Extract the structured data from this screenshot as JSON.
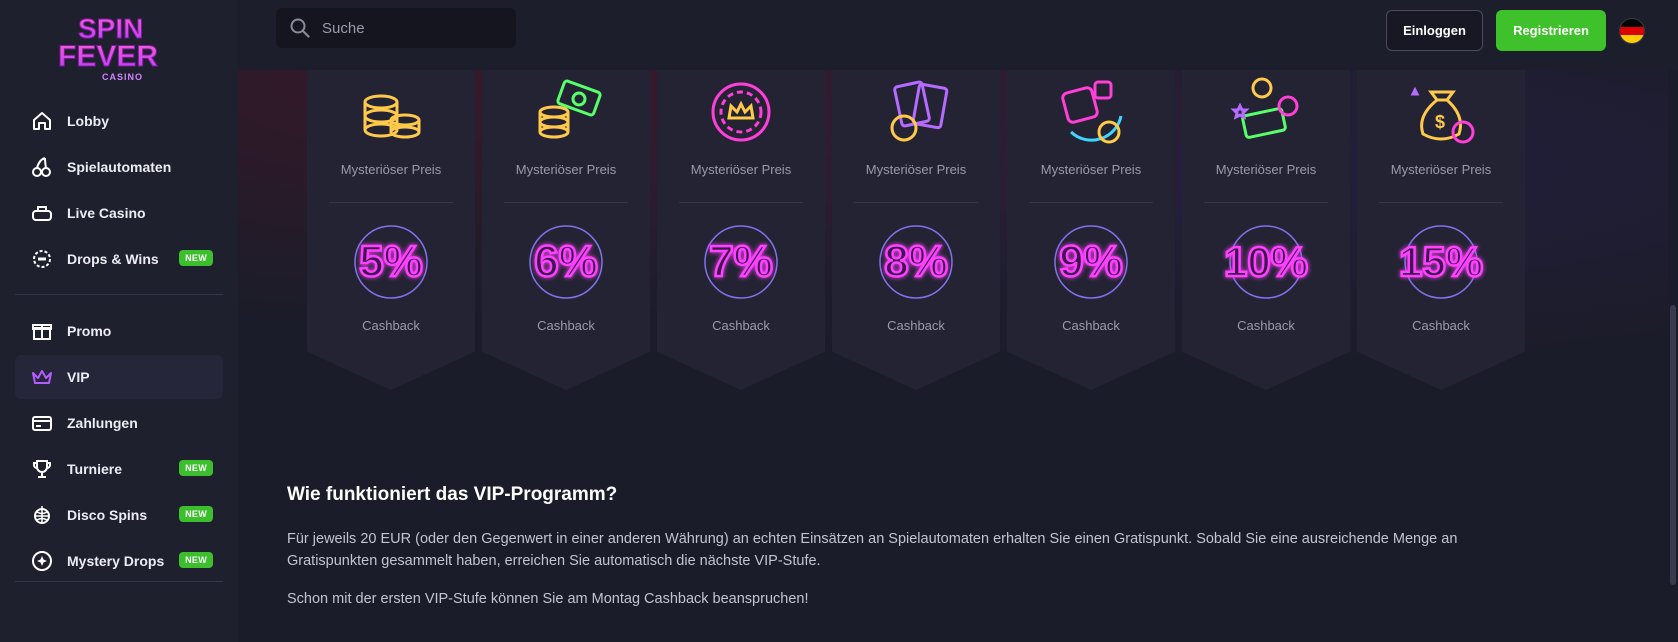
{
  "logo": {
    "line1": "SPIN",
    "line2": "FEVER",
    "sub": "CASINO"
  },
  "search": {
    "placeholder": "Suche"
  },
  "header": {
    "login": "Einloggen",
    "register": "Registrieren",
    "language_flag": "de-flag-icon"
  },
  "sidebar": {
    "items": [
      {
        "label": "Lobby",
        "icon": "home-icon"
      },
      {
        "label": "Spielautomaten",
        "icon": "cherries-icon"
      },
      {
        "label": "Live Casino",
        "icon": "live-table-icon"
      },
      {
        "label": "Drops & Wins",
        "icon": "drops-wins-icon",
        "badge": "NEW"
      },
      {
        "label": "Promo",
        "icon": "gift-icon"
      },
      {
        "label": "VIP",
        "icon": "crown-icon",
        "active": true
      },
      {
        "label": "Zahlungen",
        "icon": "card-icon"
      },
      {
        "label": "Turniere",
        "icon": "trophy-icon",
        "badge": "NEW"
      },
      {
        "label": "Disco Spins",
        "icon": "disco-ball-icon",
        "badge": "NEW"
      },
      {
        "label": "Mystery Drops",
        "icon": "mystery-icon",
        "badge": "NEW"
      }
    ]
  },
  "cards": [
    {
      "prize": "Mysteriöser Preis",
      "percent": "5%",
      "cashback": "Cashback",
      "icon": "coin-stacks-icon"
    },
    {
      "prize": "Mysteriöser Preis",
      "percent": "6%",
      "cashback": "Cashback",
      "icon": "cash-coins-icon"
    },
    {
      "prize": "Mysteriöser Preis",
      "percent": "7%",
      "cashback": "Cashback",
      "icon": "crown-chip-icon"
    },
    {
      "prize": "Mysteriöser Preis",
      "percent": "8%",
      "cashback": "Cashback",
      "icon": "playing-cards-icon"
    },
    {
      "prize": "Mysteriöser Preis",
      "percent": "9%",
      "cashback": "Cashback",
      "icon": "dice-icon"
    },
    {
      "prize": "Mysteriöser Preis",
      "percent": "10%",
      "cashback": "Cashback",
      "icon": "cash-chips-icon"
    },
    {
      "prize": "Mysteriöser Preis",
      "percent": "15%",
      "cashback": "Cashback",
      "icon": "money-bag-icon"
    }
  ],
  "vip": {
    "title": "Wie funktioniert das VIP-Programm?",
    "text1": "Für jeweils 20 EUR (oder den Gegenwert in einer anderen Währung) an echten Einsätzen an Spielautomaten erhalten Sie einen Gratispunkt. Sobald Sie eine ausreichende Menge an Gratispunkten gesammelt haben, erreichen Sie automatisch die nächste VIP-Stufe.",
    "text2": "Schon mit der ersten VIP-Stufe können Sie am Montag Cashback beanspruchen!"
  }
}
